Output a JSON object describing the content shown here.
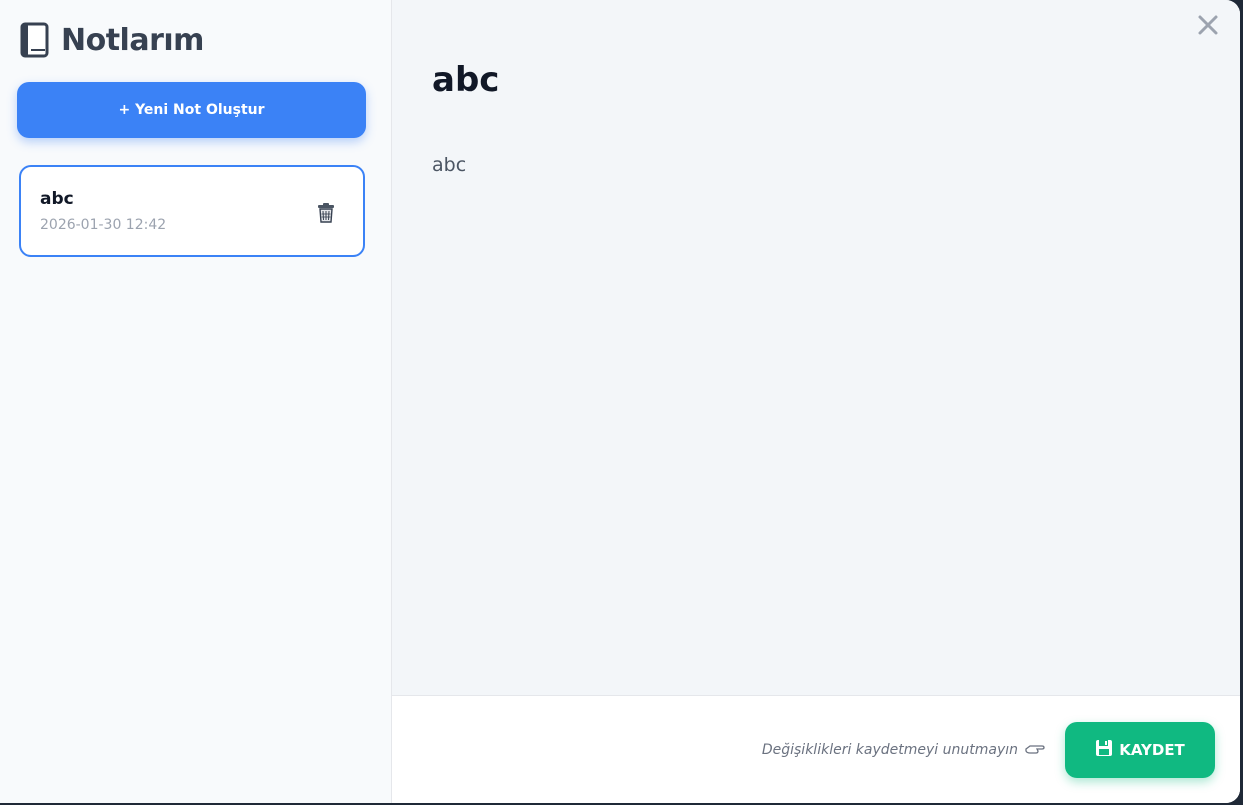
{
  "sidebar": {
    "title": "Notlarım",
    "title_icon": "book-icon",
    "new_note_label": "+ Yeni Not Oluştur",
    "notes": [
      {
        "title": "abc",
        "date": "2026-01-30 12:42",
        "delete_icon": "trash-icon"
      }
    ]
  },
  "editor": {
    "title": "abc",
    "body": "abc",
    "close_icon": "close-icon"
  },
  "footer": {
    "hint": "Değişiklikleri kaydetmeyi unutmayın",
    "hint_icon": "pointing-hand-icon",
    "save_label": "KAYDET",
    "save_icon": "floppy-disk-icon"
  },
  "colors": {
    "accent": "#3b82f6",
    "save": "#10b981",
    "sidebar_bg": "#f8fafc",
    "editor_bg": "#f3f6f9"
  }
}
